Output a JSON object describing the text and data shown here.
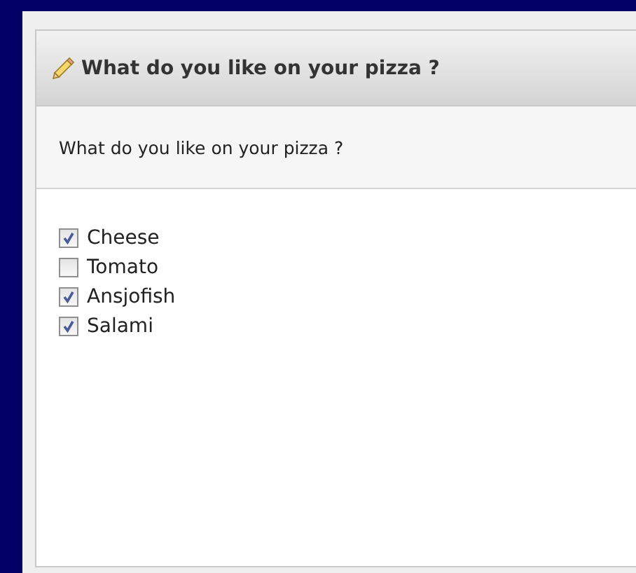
{
  "panel": {
    "title": "What do you like on your pizza ?",
    "question": "What do you like on your pizza ?"
  },
  "options": [
    {
      "label": "Cheese",
      "checked": true
    },
    {
      "label": "Tomato",
      "checked": false
    },
    {
      "label": "Ansjofish",
      "checked": true
    },
    {
      "label": "Salami",
      "checked": true
    }
  ]
}
